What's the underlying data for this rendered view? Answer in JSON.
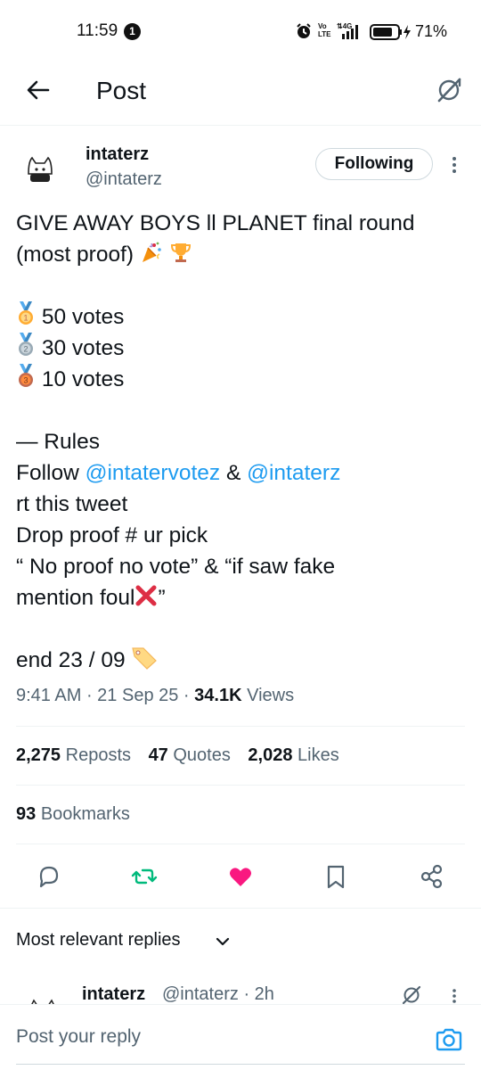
{
  "status_bar": {
    "time": "11:59",
    "notification_count": "1",
    "volte": "Vo\nLTE",
    "network": "4G",
    "battery_percent": "71%"
  },
  "header": {
    "title": "Post"
  },
  "author": {
    "name": "intaterz",
    "handle": "@intaterz",
    "follow_label": "Following"
  },
  "tweet": {
    "line1": "GIVE AWAY BOYS ll PLANET final round",
    "line2_text": "(most proof)",
    "prize1": "50 votes",
    "prize2": "30 votes",
    "prize3": "10 votes",
    "rules_title": "— Rules",
    "follow_prefix": "Follow",
    "mention1": "@intatervotez",
    "amp": "&",
    "mention2": "@intaterz",
    "rt_line": "rt this tweet",
    "drop_line": "Drop proof # ur pick",
    "quote_line": "“ No proof no vote” & “if saw fake",
    "mention_line": "mention foul",
    "end_line": "end 23 / 09",
    "closing_quote": "”"
  },
  "meta": {
    "time": "9:41 AM",
    "date": "21 Sep 25",
    "views_count": "34.1K",
    "views_label": "Views"
  },
  "stats": {
    "reposts_count": "2,275",
    "reposts_label": "Reposts",
    "quotes_count": "47",
    "quotes_label": "Quotes",
    "likes_count": "2,028",
    "likes_label": "Likes",
    "bookmarks_count": "93",
    "bookmarks_label": "Bookmarks"
  },
  "colors": {
    "accent": "#1d9bf0",
    "retweet_green": "#00ba7c",
    "like_pink": "#f91880",
    "text_primary": "#0f1419",
    "text_secondary": "#536471"
  },
  "replies": {
    "sort_label": "Most relevant replies",
    "first_reply_name": "intaterz",
    "first_reply_handle": "@intaterz · 2h"
  },
  "reply_bar": {
    "placeholder": "Post your reply"
  }
}
